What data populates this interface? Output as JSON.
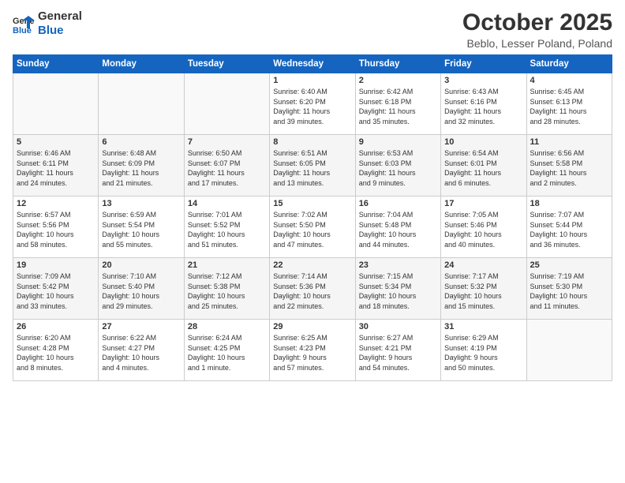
{
  "logo": {
    "general": "General",
    "blue": "Blue"
  },
  "title": "October 2025",
  "location": "Beblo, Lesser Poland, Poland",
  "weekdays": [
    "Sunday",
    "Monday",
    "Tuesday",
    "Wednesday",
    "Thursday",
    "Friday",
    "Saturday"
  ],
  "weeks": [
    [
      {
        "day": "",
        "info": ""
      },
      {
        "day": "",
        "info": ""
      },
      {
        "day": "",
        "info": ""
      },
      {
        "day": "1",
        "info": "Sunrise: 6:40 AM\nSunset: 6:20 PM\nDaylight: 11 hours\nand 39 minutes."
      },
      {
        "day": "2",
        "info": "Sunrise: 6:42 AM\nSunset: 6:18 PM\nDaylight: 11 hours\nand 35 minutes."
      },
      {
        "day": "3",
        "info": "Sunrise: 6:43 AM\nSunset: 6:16 PM\nDaylight: 11 hours\nand 32 minutes."
      },
      {
        "day": "4",
        "info": "Sunrise: 6:45 AM\nSunset: 6:13 PM\nDaylight: 11 hours\nand 28 minutes."
      }
    ],
    [
      {
        "day": "5",
        "info": "Sunrise: 6:46 AM\nSunset: 6:11 PM\nDaylight: 11 hours\nand 24 minutes."
      },
      {
        "day": "6",
        "info": "Sunrise: 6:48 AM\nSunset: 6:09 PM\nDaylight: 11 hours\nand 21 minutes."
      },
      {
        "day": "7",
        "info": "Sunrise: 6:50 AM\nSunset: 6:07 PM\nDaylight: 11 hours\nand 17 minutes."
      },
      {
        "day": "8",
        "info": "Sunrise: 6:51 AM\nSunset: 6:05 PM\nDaylight: 11 hours\nand 13 minutes."
      },
      {
        "day": "9",
        "info": "Sunrise: 6:53 AM\nSunset: 6:03 PM\nDaylight: 11 hours\nand 9 minutes."
      },
      {
        "day": "10",
        "info": "Sunrise: 6:54 AM\nSunset: 6:01 PM\nDaylight: 11 hours\nand 6 minutes."
      },
      {
        "day": "11",
        "info": "Sunrise: 6:56 AM\nSunset: 5:58 PM\nDaylight: 11 hours\nand 2 minutes."
      }
    ],
    [
      {
        "day": "12",
        "info": "Sunrise: 6:57 AM\nSunset: 5:56 PM\nDaylight: 10 hours\nand 58 minutes."
      },
      {
        "day": "13",
        "info": "Sunrise: 6:59 AM\nSunset: 5:54 PM\nDaylight: 10 hours\nand 55 minutes."
      },
      {
        "day": "14",
        "info": "Sunrise: 7:01 AM\nSunset: 5:52 PM\nDaylight: 10 hours\nand 51 minutes."
      },
      {
        "day": "15",
        "info": "Sunrise: 7:02 AM\nSunset: 5:50 PM\nDaylight: 10 hours\nand 47 minutes."
      },
      {
        "day": "16",
        "info": "Sunrise: 7:04 AM\nSunset: 5:48 PM\nDaylight: 10 hours\nand 44 minutes."
      },
      {
        "day": "17",
        "info": "Sunrise: 7:05 AM\nSunset: 5:46 PM\nDaylight: 10 hours\nand 40 minutes."
      },
      {
        "day": "18",
        "info": "Sunrise: 7:07 AM\nSunset: 5:44 PM\nDaylight: 10 hours\nand 36 minutes."
      }
    ],
    [
      {
        "day": "19",
        "info": "Sunrise: 7:09 AM\nSunset: 5:42 PM\nDaylight: 10 hours\nand 33 minutes."
      },
      {
        "day": "20",
        "info": "Sunrise: 7:10 AM\nSunset: 5:40 PM\nDaylight: 10 hours\nand 29 minutes."
      },
      {
        "day": "21",
        "info": "Sunrise: 7:12 AM\nSunset: 5:38 PM\nDaylight: 10 hours\nand 25 minutes."
      },
      {
        "day": "22",
        "info": "Sunrise: 7:14 AM\nSunset: 5:36 PM\nDaylight: 10 hours\nand 22 minutes."
      },
      {
        "day": "23",
        "info": "Sunrise: 7:15 AM\nSunset: 5:34 PM\nDaylight: 10 hours\nand 18 minutes."
      },
      {
        "day": "24",
        "info": "Sunrise: 7:17 AM\nSunset: 5:32 PM\nDaylight: 10 hours\nand 15 minutes."
      },
      {
        "day": "25",
        "info": "Sunrise: 7:19 AM\nSunset: 5:30 PM\nDaylight: 10 hours\nand 11 minutes."
      }
    ],
    [
      {
        "day": "26",
        "info": "Sunrise: 6:20 AM\nSunset: 4:28 PM\nDaylight: 10 hours\nand 8 minutes."
      },
      {
        "day": "27",
        "info": "Sunrise: 6:22 AM\nSunset: 4:27 PM\nDaylight: 10 hours\nand 4 minutes."
      },
      {
        "day": "28",
        "info": "Sunrise: 6:24 AM\nSunset: 4:25 PM\nDaylight: 10 hours\nand 1 minute."
      },
      {
        "day": "29",
        "info": "Sunrise: 6:25 AM\nSunset: 4:23 PM\nDaylight: 9 hours\nand 57 minutes."
      },
      {
        "day": "30",
        "info": "Sunrise: 6:27 AM\nSunset: 4:21 PM\nDaylight: 9 hours\nand 54 minutes."
      },
      {
        "day": "31",
        "info": "Sunrise: 6:29 AM\nSunset: 4:19 PM\nDaylight: 9 hours\nand 50 minutes."
      },
      {
        "day": "",
        "info": ""
      }
    ]
  ]
}
